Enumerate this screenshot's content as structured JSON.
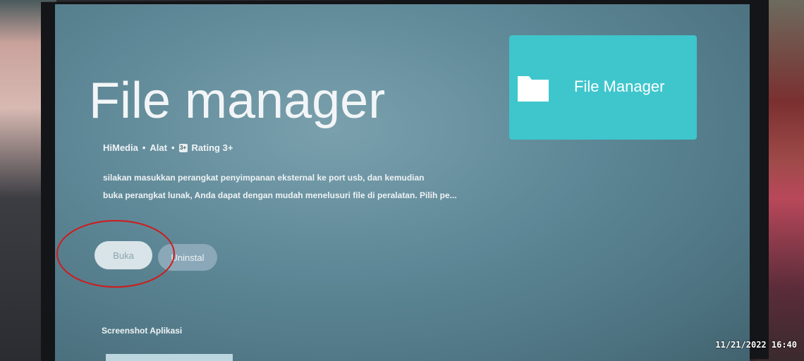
{
  "app": {
    "title": "File manager",
    "developer": "HiMedia",
    "separator": "•",
    "category": "Alat",
    "rating_badge": "3+",
    "rating": "Rating 3+",
    "description_line1": "silakan masukkan perangkat penyimpanan eksternal ke port usb, dan kemudian",
    "description_line2": "buka perangkat lunak, Anda dapat dengan mudah menelusuri file di peralatan. Pilih pe..."
  },
  "actions": {
    "open_label": "Buka",
    "uninstall_label": "Uninstal"
  },
  "sections": {
    "screenshots_label": "Screenshot Aplikasi"
  },
  "banner": {
    "text": "File Manager",
    "icon": "folder-icon",
    "color": "#3ec6cc"
  },
  "overlay": {
    "timestamp": "11/21/2022 16:40",
    "annotation_color": "#d01a1a"
  }
}
